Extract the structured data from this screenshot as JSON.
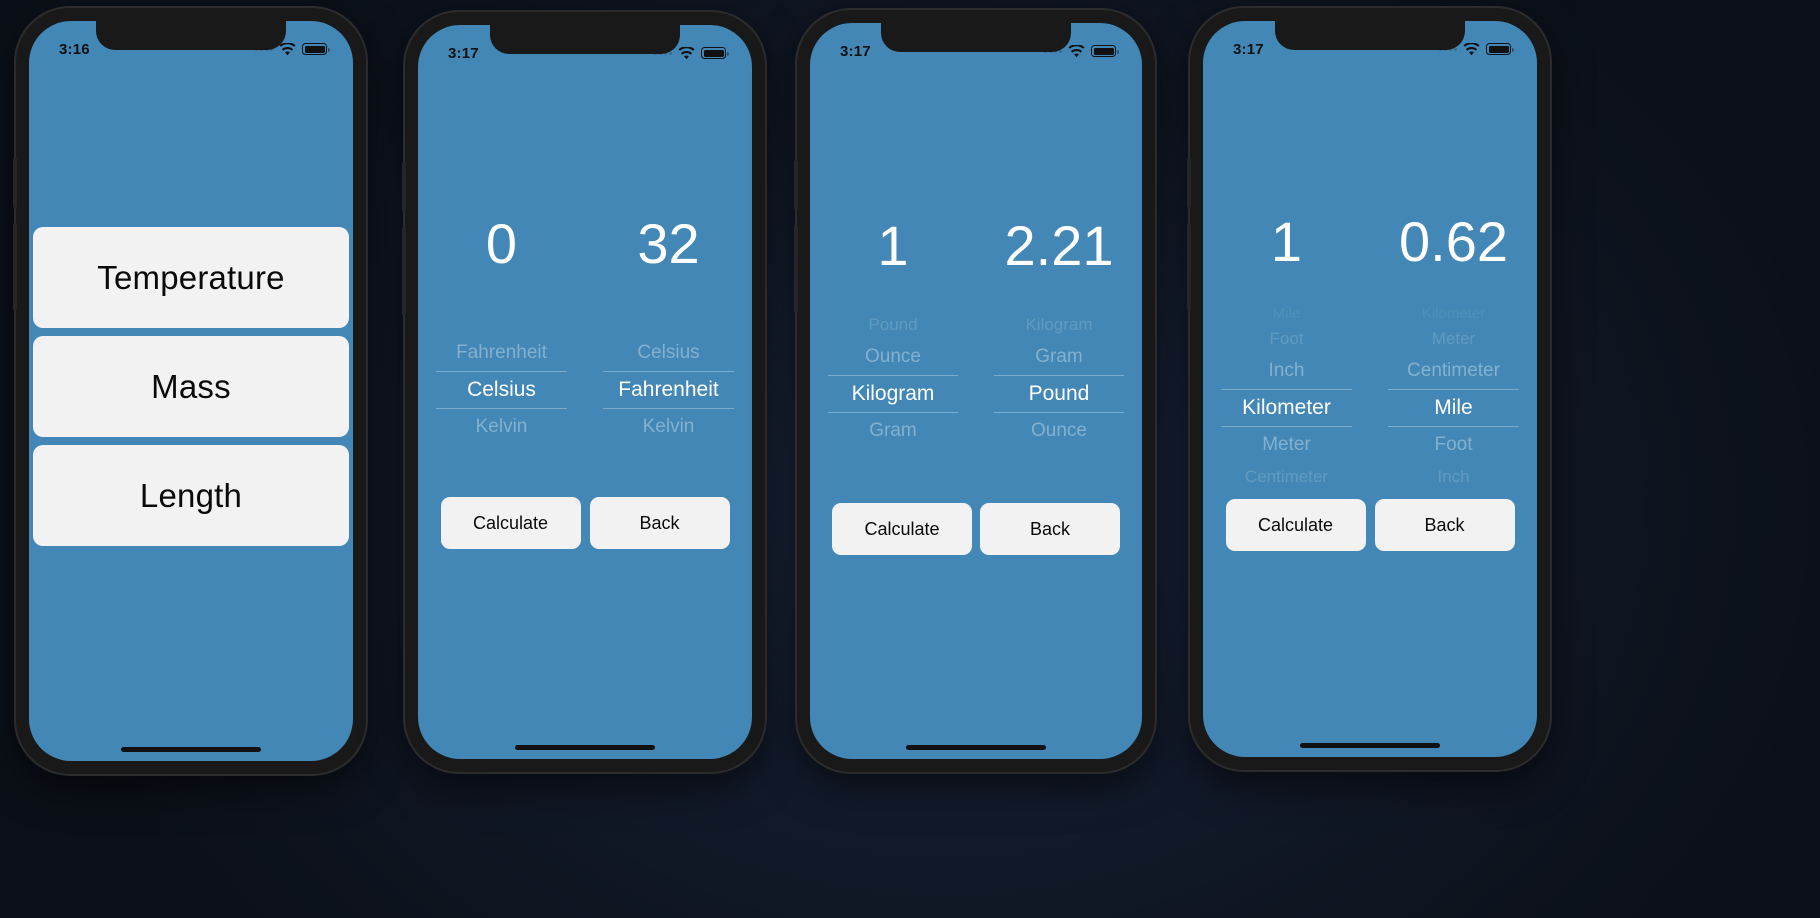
{
  "theme": {
    "screen_bg": "#4287b5",
    "card_bg": "#f2f2f2",
    "card_text": "#0a0a0a",
    "value_text": "#ffffff",
    "frame": "#191919"
  },
  "phones": [
    {
      "id": "phone-menu",
      "status": {
        "time": "3:16",
        "wifi_icon": "wifi-icon",
        "battery_icon": "battery-icon",
        "signal_icon": "signal-dots-icon"
      },
      "type": "menu",
      "menu": {
        "items": [
          {
            "label": "Temperature"
          },
          {
            "label": "Mass"
          },
          {
            "label": "Length"
          }
        ]
      }
    },
    {
      "id": "phone-temperature",
      "status": {
        "time": "3:17",
        "wifi_icon": "wifi-icon",
        "battery_icon": "battery-icon",
        "signal_icon": "signal-dots-icon"
      },
      "type": "converter",
      "left": {
        "value": "0",
        "rows": [
          {
            "label": "Fahrenheit",
            "state": "faded-1"
          },
          {
            "label": "Celsius",
            "state": "selected"
          },
          {
            "label": "Kelvin",
            "state": "faded-1"
          }
        ]
      },
      "right": {
        "value": "32",
        "rows": [
          {
            "label": "Celsius",
            "state": "faded-1"
          },
          {
            "label": "Fahrenheit",
            "state": "selected"
          },
          {
            "label": "Kelvin",
            "state": "faded-1"
          }
        ]
      },
      "buttons": {
        "calculate": "Calculate",
        "back": "Back"
      }
    },
    {
      "id": "phone-mass",
      "status": {
        "time": "3:17",
        "wifi_icon": "wifi-icon",
        "battery_icon": "battery-icon",
        "signal_icon": "signal-dots-icon"
      },
      "type": "converter",
      "left": {
        "value": "1",
        "rows": [
          {
            "label": "Pound",
            "state": "faded-2"
          },
          {
            "label": "Ounce",
            "state": "faded-1"
          },
          {
            "label": "Kilogram",
            "state": "selected"
          },
          {
            "label": "Gram",
            "state": "faded-1"
          }
        ]
      },
      "right": {
        "value": "2.21",
        "rows": [
          {
            "label": "Kilogram",
            "state": "faded-2"
          },
          {
            "label": "Gram",
            "state": "faded-1"
          },
          {
            "label": "Pound",
            "state": "selected"
          },
          {
            "label": "Ounce",
            "state": "faded-1"
          }
        ]
      },
      "buttons": {
        "calculate": "Calculate",
        "back": "Back"
      }
    },
    {
      "id": "phone-length",
      "status": {
        "time": "3:17",
        "wifi_icon": "wifi-icon",
        "battery_icon": "battery-icon",
        "signal_icon": "signal-dots-icon"
      },
      "type": "converter",
      "left": {
        "value": "1",
        "rows": [
          {
            "label": "Mile",
            "state": "faded-3"
          },
          {
            "label": "Foot",
            "state": "faded-2"
          },
          {
            "label": "Inch",
            "state": "faded-1"
          },
          {
            "label": "Kilometer",
            "state": "selected"
          },
          {
            "label": "Meter",
            "state": "faded-1"
          },
          {
            "label": "Centimeter",
            "state": "faded-2"
          }
        ]
      },
      "right": {
        "value": "0.62",
        "rows": [
          {
            "label": "Kilometer",
            "state": "faded-3"
          },
          {
            "label": "Meter",
            "state": "faded-2"
          },
          {
            "label": "Centimeter",
            "state": "faded-1"
          },
          {
            "label": "Mile",
            "state": "selected"
          },
          {
            "label": "Foot",
            "state": "faded-1"
          },
          {
            "label": "Inch",
            "state": "faded-2"
          }
        ]
      },
      "buttons": {
        "calculate": "Calculate",
        "back": "Back"
      }
    }
  ]
}
